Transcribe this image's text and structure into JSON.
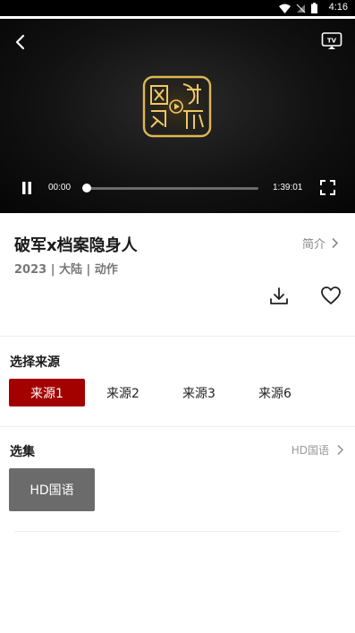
{
  "status_bar": {
    "time": "4:16"
  },
  "player": {
    "current_time": "00:00",
    "duration": "1:39:01",
    "progress": 0.0
  },
  "movie": {
    "title": "破军x档案隐身人",
    "meta": "2023 | 大陆 | 动作",
    "intro_label": "简介"
  },
  "sources": {
    "label": "选择来源",
    "items": [
      "来源1",
      "来源2",
      "来源3",
      "来源6"
    ],
    "active_index": 0
  },
  "episodes": {
    "label": "选集",
    "more_label": "HD国语",
    "items": [
      "HD国语"
    ]
  },
  "colors": {
    "accent": "#a30000",
    "episode_bg": "#6b6b6b"
  }
}
